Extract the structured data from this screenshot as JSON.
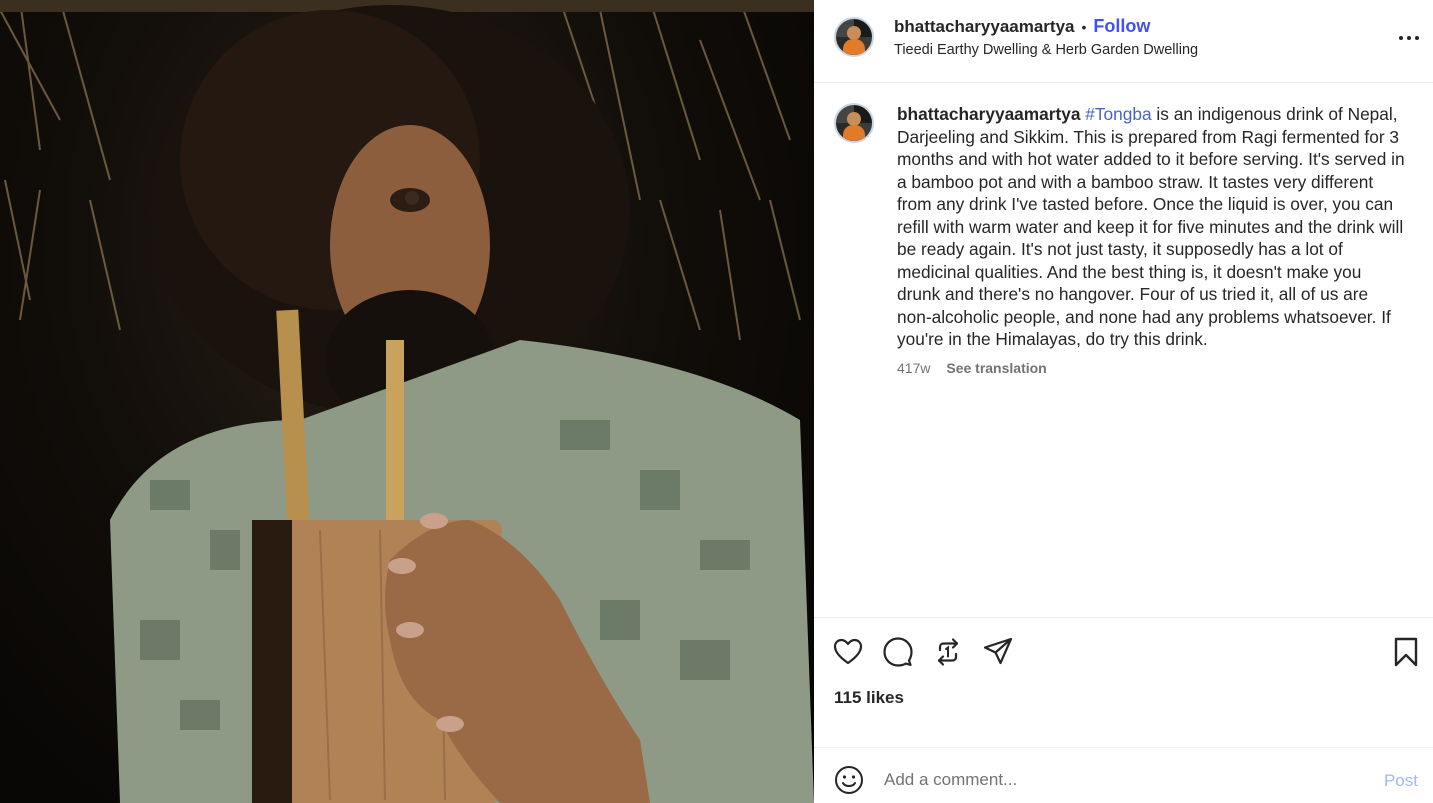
{
  "photo": {
    "alt_icon": "photo-man-drinking-tongba"
  },
  "header": {
    "username": "bhattacharyyaamartya",
    "separator": "•",
    "follow_label": "Follow",
    "location": "Tieedi Earthy Dwelling & Herb Garden Dwelling",
    "more_icon": "more-horizontal-icon"
  },
  "caption": {
    "username": "bhattacharyyaamartya",
    "hashtag": "#Tongba",
    "text": " is an indigenous drink of Nepal, Darjeeling and Sikkim. This is prepared from Ragi fermented for 3 months and with hot water added to it before serving. It's served in a bamboo pot and with a bamboo straw. It tastes very different from any drink I've tasted before. Once the liquid is over, you can refill with warm water and keep it for five minutes and the drink will be ready again. It's not just tasty, it supposedly has a lot of medicinal qualities. And the best thing is, it doesn't make you drunk and there's no hangover. Four of us tried it, all of us are non-alcoholic people, and none had any problems whatsoever. If you're in the Himalayas, do try this drink.",
    "age": "417w",
    "translate_label": "See translation"
  },
  "actions": {
    "icons": [
      "heart-icon",
      "comment-icon",
      "repost-icon",
      "share-icon",
      "bookmark-icon"
    ],
    "likes": "115 likes"
  },
  "comment": {
    "placeholder": "Add a comment...",
    "post_label": "Post",
    "emoji_icon": "emoji-icon"
  },
  "colors": {
    "follow": "#4150f7",
    "hashtag": "#4b62c9",
    "post_disabled": "#a5b6f5",
    "meta_text": "#737373",
    "divider": "#efefef"
  }
}
